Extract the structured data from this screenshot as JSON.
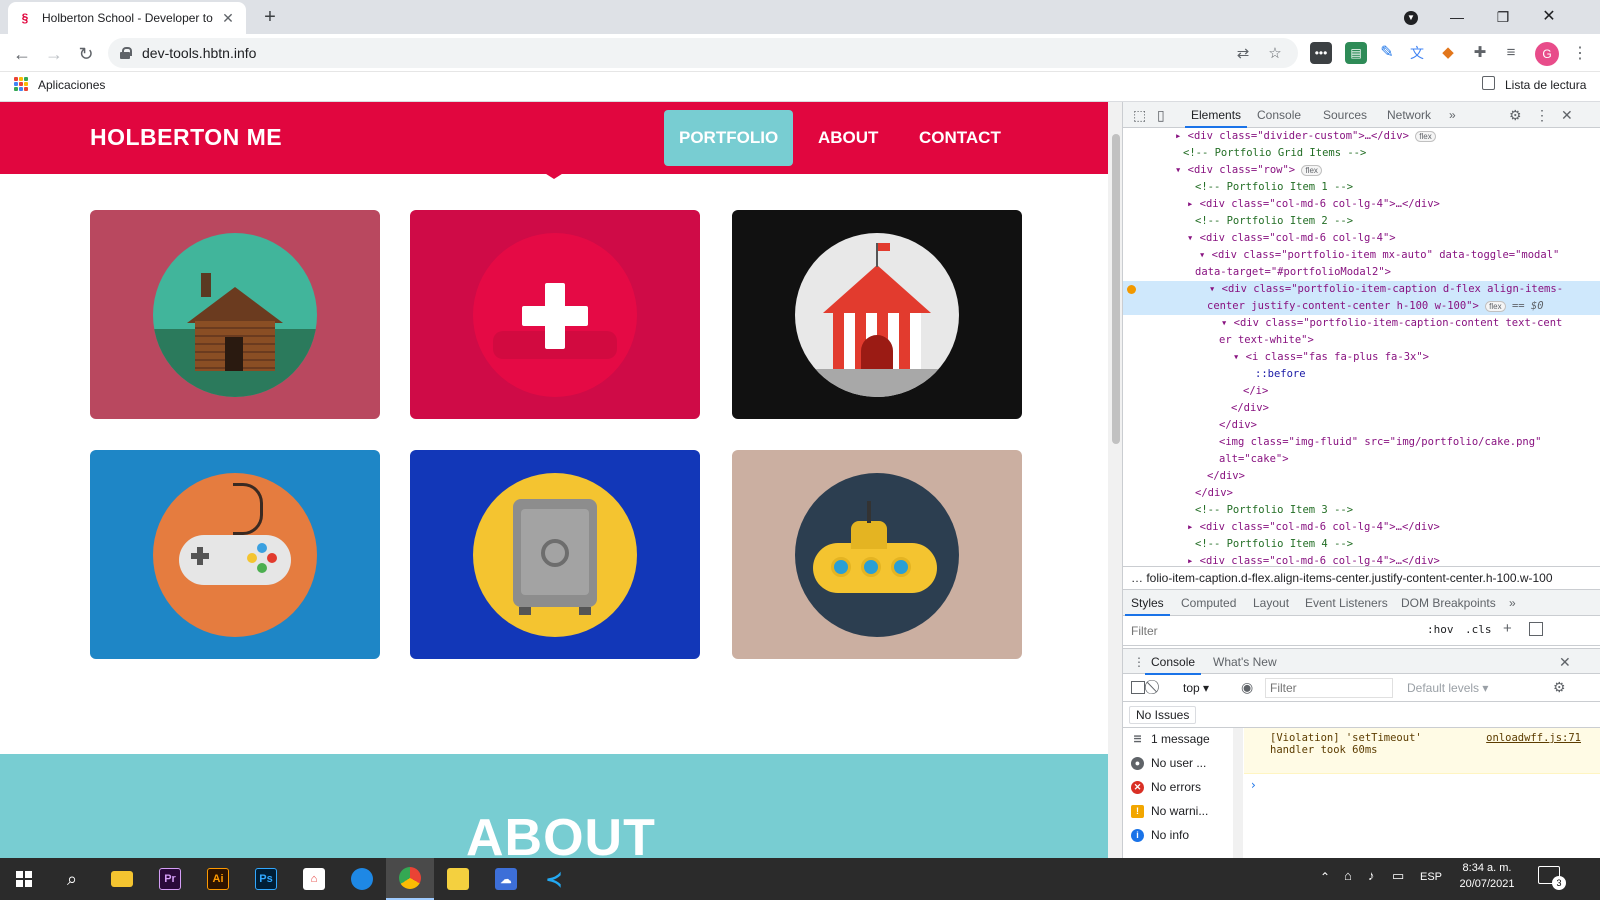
{
  "browser": {
    "tab_title": "Holberton School - Developer to",
    "url": "dev-tools.hbtn.info",
    "bookmarks": {
      "apps_label": "Aplicaciones",
      "reading_list_label": "Lista de lectura"
    },
    "profile_initial": "G"
  },
  "site": {
    "brand": "HOLBERTON ME",
    "nav": [
      "PORTFOLIO",
      "ABOUT",
      "CONTACT"
    ],
    "active_nav": "PORTFOLIO",
    "colors": {
      "primary": "#e1063f",
      "accent": "#78cdd2"
    },
    "portfolio_items": [
      {
        "icon": "cabin-icon",
        "bg": "#b9485f"
      },
      {
        "icon": "plus-icon",
        "bg": "#cf0b47"
      },
      {
        "icon": "circus-tent-icon",
        "bg": "#111111"
      },
      {
        "icon": "game-controller-icon",
        "bg": "#1e86c6"
      },
      {
        "icon": "safe-icon",
        "bg": "#1237b8"
      },
      {
        "icon": "submarine-icon",
        "bg": "#cbafa1"
      }
    ],
    "section_heading": "ABOUT"
  },
  "devtools": {
    "tabs": [
      "Elements",
      "Console",
      "Sources",
      "Network"
    ],
    "active_tab": "Elements",
    "dom_lines": [
      {
        "t": "<div class=\"divider-custom\">…</div>",
        "badge": "flex"
      },
      {
        "t": "<!-- Portfolio Grid Items -->"
      },
      {
        "t": "<div class=\"row\">",
        "badge": "flex"
      },
      {
        "t": "<!-- Portfolio Item 1 -->"
      },
      {
        "t": "<div class=\"col-md-6 col-lg-4\">…</div>"
      },
      {
        "t": "<!-- Portfolio Item 2 -->"
      },
      {
        "t": "<div class=\"col-md-6 col-lg-4\">"
      },
      {
        "t": "<div class=\"portfolio-item mx-auto\" data-toggle=\"modal\""
      },
      {
        "t": "data-target=\"#portfolioModal2\">"
      },
      {
        "t": "<div class=\"portfolio-item-caption d-flex align-items-"
      },
      {
        "t": "center justify-content-center h-100 w-100\">",
        "badge": "flex",
        "suffix": "== $0"
      },
      {
        "t": "<div class=\"portfolio-item-caption-content text-cent"
      },
      {
        "t": "er text-white\">"
      },
      {
        "t": "<i class=\"fas fa-plus fa-3x\">"
      },
      {
        "t": "::before"
      },
      {
        "t": "</i>"
      },
      {
        "t": "</div>"
      },
      {
        "t": "</div>"
      },
      {
        "t": "<img class=\"img-fluid\" src=\"img/portfolio/cake.png\""
      },
      {
        "t": "alt=\"cake\">"
      },
      {
        "t": "</div>"
      },
      {
        "t": "</div>"
      },
      {
        "t": "<!-- Portfolio Item 3 -->"
      },
      {
        "t": "<div class=\"col-md-6 col-lg-4\">…</div>"
      },
      {
        "t": "<!-- Portfolio Item 4 -->"
      },
      {
        "t": "<div class=\"col-md-6 col-lg-4\">…</div>"
      }
    ],
    "breadcrumb": "folio-item-caption.d-flex.align-items-center.justify-content-center.h-100.w-100",
    "style_tabs": [
      "Styles",
      "Computed",
      "Layout",
      "Event Listeners",
      "DOM Breakpoints"
    ],
    "filter_placeholder": "Filter",
    "hov_label": ":hov",
    "cls_label": ".cls",
    "drawer_tabs": [
      "Console",
      "What's New"
    ],
    "context": "top",
    "console_filter_placeholder": "Filter",
    "levels": "Default levels",
    "issues": "No Issues",
    "sidebar": [
      "1 message",
      "No user ...",
      "No errors",
      "No warni...",
      "No info"
    ],
    "message": {
      "text1": "[Violation] 'setTimeout'",
      "text2": "handler took 60ms",
      "source": "onloadwff.js:71"
    }
  },
  "taskbar": {
    "time": "8:34 a. m.",
    "date": "20/07/2021",
    "lang": "ESP",
    "notifications": "3"
  }
}
